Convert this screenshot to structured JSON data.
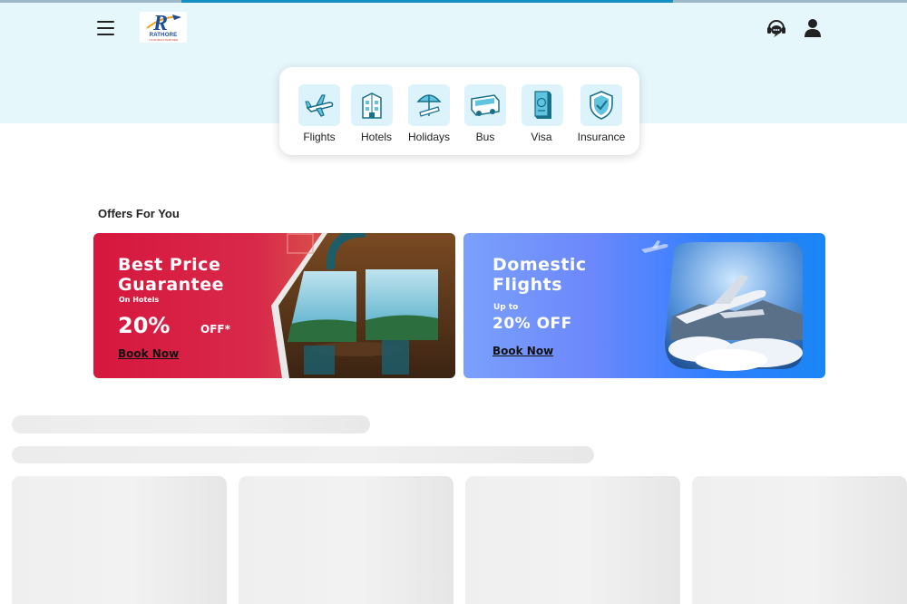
{
  "header": {
    "logo_letter": "R",
    "logo_name": "RATHORE",
    "logo_tagline": "YOUR BEST PARTNER",
    "page_load_progress": 0.742
  },
  "services": [
    {
      "label": "Flights",
      "icon": "airplane-icon"
    },
    {
      "label": "Hotels",
      "icon": "hotel-icon"
    },
    {
      "label": "Holidays",
      "icon": "beach-umbrella-icon"
    },
    {
      "label": "Bus",
      "icon": "bus-icon"
    },
    {
      "label": "Visa",
      "icon": "passport-icon"
    },
    {
      "label": "Insurance",
      "icon": "shield-check-icon"
    }
  ],
  "offers": {
    "title": "Offers For You",
    "hotel_banner": {
      "line1": "Best Price",
      "line2": "Guarantee",
      "subline": "On Hotels",
      "discount": "20%",
      "discount_suffix": "OFF*",
      "cta": "Book Now"
    },
    "flight_banner": {
      "line1": "Domestic",
      "line2": "Flights",
      "upto": "Up to",
      "discount": "20% OFF",
      "cta": "Book Now"
    }
  },
  "colors": {
    "hero_bg": "#e6f7fc",
    "accent": "#1390c0",
    "hotel_banner": "#d6173e",
    "flight_banner": "#2f7fff",
    "icon_tile": "#dcf3fb"
  }
}
